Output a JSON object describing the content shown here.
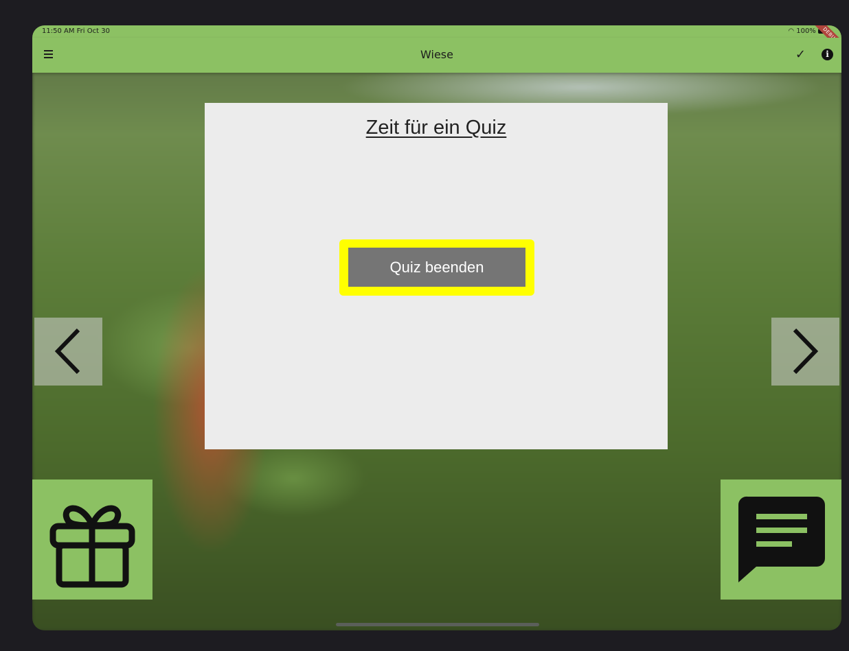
{
  "status_bar": {
    "time": "11:50 AM  Fri Oct 30",
    "battery": "100%",
    "debug_banner": "DEBUG"
  },
  "app_bar": {
    "title": "Wiese",
    "menu_icon": "menu-icon",
    "check_icon": "check-icon",
    "info_icon": "info-icon"
  },
  "quiz_card": {
    "title": "Zeit für ein Quiz",
    "button_label": "Quiz beenden",
    "highlight_color": "#ffff00",
    "button_color": "#757575"
  },
  "navigation": {
    "previous_icon": "chevron-left-icon",
    "next_icon": "chevron-right-icon"
  },
  "actions": {
    "gift_icon": "gift-icon",
    "chat_icon": "chat-icon"
  },
  "colors": {
    "accent": "#8cc163",
    "background": "#1d1c21"
  }
}
